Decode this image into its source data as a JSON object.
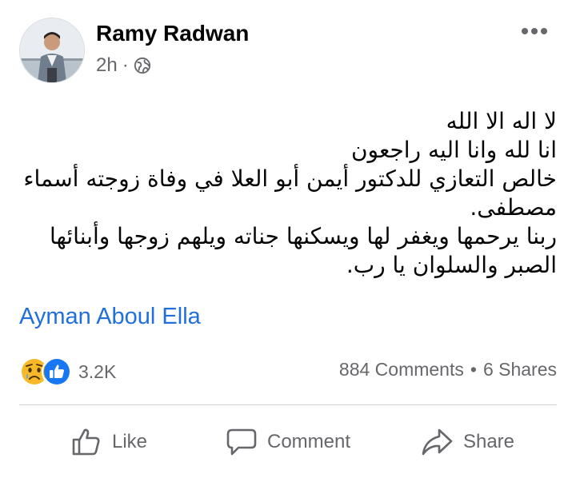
{
  "post": {
    "author": "Ramy Radwan",
    "time": "2h",
    "separator": "·",
    "audience_icon": "globe-icon",
    "lines": [
      "لا اله الا الله",
      "انا لله وانا اليه راجعون",
      "خالص التعازي للدكتور أيمن أبو العلا في وفاة زوجته أسماء",
      "مصطفى.",
      "ربنا يرحمها ويغفر لها ويسكنها جناته ويلهم زوجها وأبنائها",
      "الصبر والسلوان يا رب."
    ],
    "tagged_user": "Ayman Aboul Ella"
  },
  "stats": {
    "reactions_count": "3.2K",
    "reaction_icons": [
      "sad-reaction-icon",
      "like-reaction-icon"
    ],
    "comments": "884 Comments",
    "dot": "•",
    "shares": "6 Shares"
  },
  "actions": {
    "like": "Like",
    "comment": "Comment",
    "share": "Share"
  },
  "colors": {
    "link": "#216fdb",
    "secondary_text": "#65676b",
    "like_blue": "#1877f2",
    "sad_yellow": "#f7b928"
  }
}
